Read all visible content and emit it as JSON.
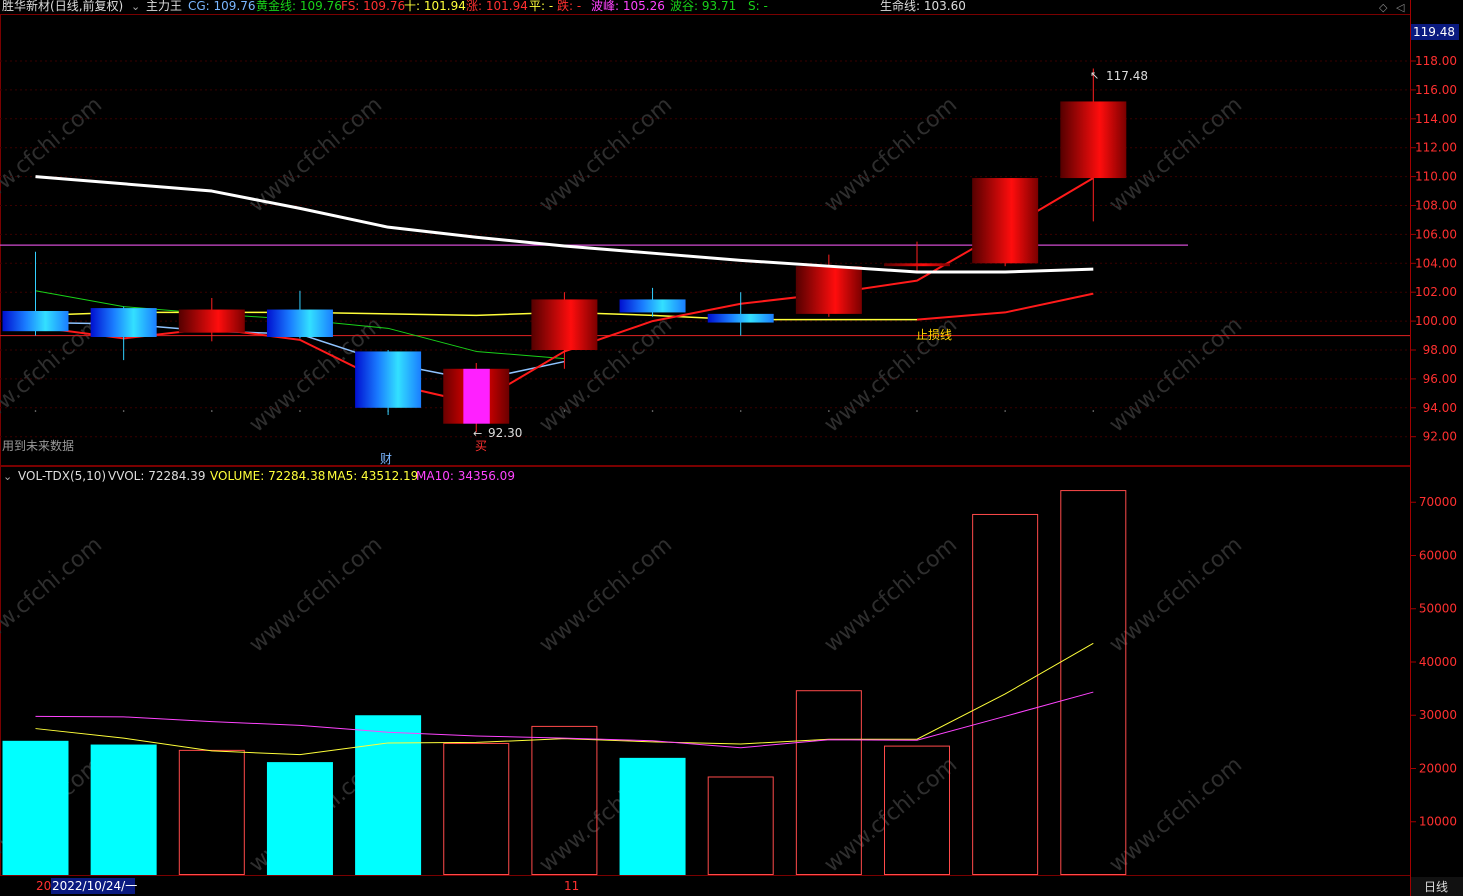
{
  "stock": {
    "name": "胜华新材",
    "mode": "(日线,前复权)"
  },
  "indicator_bar": {
    "name": "主力王",
    "items": [
      {
        "label": "CG:",
        "value": "109.76",
        "color": "#7ab6ff"
      },
      {
        "label": "黄金线:",
        "value": "109.76",
        "color": "#19d219"
      },
      {
        "label": "FS:",
        "value": "109.76",
        "color": "#ff3030"
      },
      {
        "label": "十:",
        "value": "101.94",
        "color": "#ffff3a"
      },
      {
        "label": "涨:",
        "value": "101.94",
        "color": "#ff3030"
      },
      {
        "label": "平:",
        "value": "-",
        "color": "#ffff3a"
      },
      {
        "label": "跌:",
        "value": "-",
        "color": "#ff3030"
      },
      {
        "label": "波峰:",
        "value": "105.26",
        "color": "#ff44ff"
      },
      {
        "label": "波谷:",
        "value": "93.71",
        "color": "#19d219"
      },
      {
        "label": "S:",
        "value": "-",
        "color": "#19d219"
      }
    ],
    "life_line": "生命线: 103.60"
  },
  "vol_bar": {
    "name": "VOL-TDX(5,10)",
    "items": [
      {
        "label": "VVOL:",
        "value": "72284.39",
        "color": "#dddddd"
      },
      {
        "label": "VOLUME:",
        "value": "72284.38",
        "color": "#ffff3a"
      },
      {
        "label": "MA5:",
        "value": "43512.19",
        "color": "#ffff3a"
      },
      {
        "label": "MA10:",
        "value": "34356.09",
        "color": "#ff44ff"
      }
    ]
  },
  "annotations": {
    "high_label": "117.48",
    "low_label": "92.30",
    "buy_label": "买",
    "stop_loss_label": "止损线",
    "future_data_label": "用到未来数据",
    "finance_label": "财",
    "price_flag": "119.48",
    "date_left": "20",
    "date_start": "2022/10/24/一",
    "date_marker": "11",
    "period_button": "日线",
    "watermark": "www.cfchi.com"
  },
  "chart_data": [
    {
      "type": "candlestick",
      "title": "胜华新材",
      "ylim": [
        90.5,
        120.5
      ],
      "y_ticks": [
        "92.00",
        "94.00",
        "96.00",
        "98.00",
        "100.00",
        "102.00",
        "104.00",
        "106.00",
        "108.00",
        "110.00",
        "112.00",
        "114.00",
        "116.00",
        "118.00"
      ],
      "candles": [
        {
          "open": 100.7,
          "close": 99.3,
          "high": 104.8,
          "low": 99.0,
          "style": "blue"
        },
        {
          "open": 100.9,
          "close": 98.9,
          "high": 101.0,
          "low": 97.3,
          "style": "blue"
        },
        {
          "open": 99.2,
          "close": 100.8,
          "high": 101.6,
          "low": 98.6,
          "style": "red"
        },
        {
          "open": 100.8,
          "close": 98.9,
          "high": 102.1,
          "low": 98.8,
          "style": "blue"
        },
        {
          "open": 97.9,
          "close": 94.0,
          "high": 98.0,
          "low": 93.5,
          "style": "blue"
        },
        {
          "open": 92.9,
          "close": 96.7,
          "high": 97.1,
          "low": 92.3,
          "style": "magenta-red"
        },
        {
          "open": 98.0,
          "close": 101.5,
          "high": 102.0,
          "low": 96.7,
          "style": "red"
        },
        {
          "open": 101.5,
          "close": 100.6,
          "high": 102.3,
          "low": 100.3,
          "style": "blue"
        },
        {
          "open": 100.5,
          "close": 99.9,
          "high": 102.0,
          "low": 99.0,
          "style": "blue"
        },
        {
          "open": 100.5,
          "close": 103.8,
          "high": 104.6,
          "low": 100.3,
          "style": "red"
        },
        {
          "open": 103.8,
          "close": 104.0,
          "high": 105.5,
          "low": 103.3,
          "style": "red"
        },
        {
          "open": 104.0,
          "close": 109.9,
          "high": 109.9,
          "low": 103.8,
          "style": "red"
        },
        {
          "open": 109.9,
          "close": 115.2,
          "high": 117.48,
          "low": 106.9,
          "style": "red"
        }
      ],
      "lines": [
        {
          "name": "生命线",
          "color": "#ffffff",
          "width": 3,
          "values": [
            110.0,
            null,
            109.0,
            107.8,
            106.5,
            105.8,
            105.2,
            104.7,
            104.2,
            103.8,
            103.4,
            103.4,
            103.6
          ]
        },
        {
          "name": "CG",
          "color": "#8fc3ff",
          "width": 1.5,
          "values": [
            99.9,
            99.8,
            99.3,
            99.1,
            97.1,
            95.9,
            97.2,
            null,
            null,
            null,
            null,
            null,
            null
          ]
        },
        {
          "name": "黄金线",
          "color": "#19d219",
          "width": 1,
          "values": [
            102.1,
            101.0,
            100.5,
            100.1,
            99.5,
            97.9,
            97.4,
            null,
            null,
            null,
            null,
            null,
            null
          ]
        },
        {
          "name": "十",
          "color": "#ffff3a",
          "width": 1.5,
          "values": [
            100.4,
            100.6,
            100.6,
            100.6,
            100.5,
            100.4,
            100.6,
            100.4,
            100.1,
            100.1,
            100.1,
            null,
            null
          ]
        },
        {
          "name": "FS",
          "color": "#ff1a1a",
          "width": 2,
          "values": [
            99.6,
            98.8,
            99.5,
            98.7,
            95.7,
            94.3,
            97.9,
            100.0,
            101.2,
            101.9,
            102.8,
            106.3,
            109.9
          ]
        },
        {
          "name": "涨",
          "color": "#ff1a1a",
          "width": 2,
          "values": [
            null,
            null,
            null,
            null,
            null,
            null,
            null,
            null,
            null,
            null,
            100.1,
            100.6,
            101.9
          ]
        }
      ],
      "hlines": [
        {
          "name": "波峰",
          "value": 105.26,
          "color": "#d04cd0"
        },
        {
          "name": "止损线",
          "value": 99.0,
          "color": "#c81e1e"
        }
      ]
    },
    {
      "type": "bar",
      "title": "VOL-TDX(5,10)",
      "ylim": [
        0,
        73500
      ],
      "y_ticks": [
        10000,
        20000,
        30000,
        40000,
        50000,
        60000,
        70000
      ],
      "values": [
        25200,
        24500,
        23500,
        21200,
        30000,
        24800,
        28000,
        22000,
        18500,
        34700,
        24300,
        67800,
        72284.38
      ],
      "down": [
        true,
        true,
        false,
        true,
        true,
        false,
        false,
        true,
        false,
        false,
        false,
        false,
        false
      ],
      "series": [
        {
          "name": "MA5",
          "color": "#ffff3a",
          "values": [
            27500,
            25700,
            23300,
            22600,
            24800,
            24900,
            25600,
            25000,
            24600,
            25500,
            25500,
            34000,
            43512.19
          ]
        },
        {
          "name": "MA10",
          "color": "#ff44ff",
          "values": [
            29800,
            29700,
            28800,
            28100,
            26800,
            26100,
            25700,
            25200,
            23900,
            25400,
            25300,
            29800,
            34356.09
          ]
        }
      ]
    }
  ]
}
